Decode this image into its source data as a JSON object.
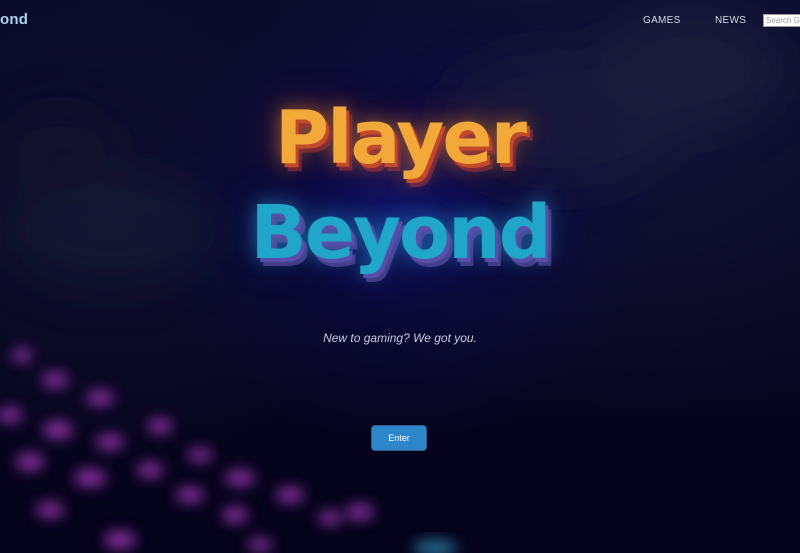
{
  "nav": {
    "brand": "ond",
    "links": [
      "GAMES",
      "NEWS"
    ],
    "search_placeholder": "Search G"
  },
  "hero": {
    "title_line1": "Player",
    "title_line2": "Beyond",
    "tagline": "New to gaming? We got you.",
    "enter_label": "Enter"
  },
  "colors": {
    "background": "#05041a",
    "title_orange": "#f2a93a",
    "title_blue": "#1fa6c9",
    "button": "#2d86c9",
    "keyboard_glow": "#b23cc8"
  }
}
